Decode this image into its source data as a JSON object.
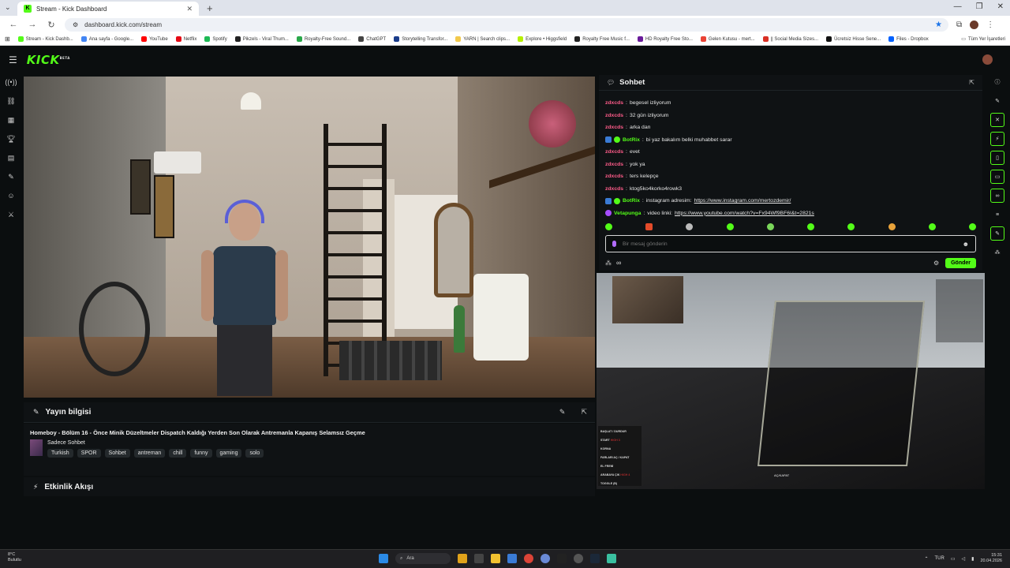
{
  "browser": {
    "tab_title": "Stream - Kick Dashboard",
    "new_tab_glyph": "+",
    "url": "dashboard.kick.com/stream",
    "window_controls": [
      "—",
      "❐",
      "✕"
    ]
  },
  "bookmarks": [
    {
      "label": "Stream - Kick Dashb...",
      "color": "#53fc18"
    },
    {
      "label": "Ana sayfa - Google...",
      "color": "#4285f4"
    },
    {
      "label": "YouTube",
      "color": "#ff0000"
    },
    {
      "label": "Netflix",
      "color": "#e50914"
    },
    {
      "label": "Spotify",
      "color": "#1db954"
    },
    {
      "label": "Pikzels - Viral Thum...",
      "color": "#222222"
    },
    {
      "label": "Royalty-Free Sound...",
      "color": "#2aa84a"
    },
    {
      "label": "ChatGPT",
      "color": "#444444"
    },
    {
      "label": "Storytelling Transfor...",
      "color": "#1a3c8a"
    },
    {
      "label": "YARN | Search clips...",
      "color": "#f2c94c"
    },
    {
      "label": "Explore • Higgsfield",
      "color": "#b6f000"
    },
    {
      "label": "Royalty Free Music f...",
      "color": "#222222"
    },
    {
      "label": "HD Royalty Free Sto...",
      "color": "#6a1b9a"
    },
    {
      "label": "Gelen Kutusu - mert...",
      "color": "#ea4335"
    },
    {
      "label": "|| Social Media Sizes...",
      "color": "#d93025"
    },
    {
      "label": "Ücretsiz Hisse Sene...",
      "color": "#111111"
    },
    {
      "label": "Files - Dropbox",
      "color": "#0061ff"
    }
  ],
  "bookmarks_all": "Tüm Yer İşaretleri",
  "kick": {
    "logo": "KICK",
    "logo_beta": "BETA"
  },
  "left_rail_icons": [
    "live-icon",
    "link-icon",
    "chart-icon",
    "trophy-icon",
    "media-icon",
    "wrench-icon",
    "users-icon",
    "mod-icon"
  ],
  "stream_info": {
    "heading": "Yayın bilgisi",
    "title": "Homeboy - Bölüm 16 - Önce Minik Düzeltmeler Dispatch Kaldığı Yerden Son Olarak Antremanla Kapanış Selamsız Geçme",
    "category": "Sadece Sohbet",
    "tags": [
      "Turkish",
      "SPOR",
      "Sohbet",
      "antreman",
      "chill",
      "funny",
      "gaming",
      "solo"
    ]
  },
  "activity": {
    "heading": "Etkinlik Akışı"
  },
  "chat": {
    "heading": "Sohbet",
    "messages": [
      {
        "user": "zdxcds",
        "color": "#ff5c8a",
        "text": "begesel izliyorum",
        "bot": false
      },
      {
        "user": "zdxcds",
        "color": "#ff5c8a",
        "text": "32 gün izliyorum",
        "bot": false
      },
      {
        "user": "zdxcds",
        "color": "#ff5c8a",
        "text": "arka dan",
        "bot": false
      },
      {
        "user": "BotRix",
        "color": "#53fc18",
        "text": "bi yaz bakalım belki muhabbet sarar",
        "bot": true
      },
      {
        "user": "zdxcds",
        "color": "#ff5c8a",
        "text": "evet",
        "bot": false
      },
      {
        "user": "zdxcds",
        "color": "#ff5c8a",
        "text": "yok ya",
        "bot": false
      },
      {
        "user": "zdxcds",
        "color": "#ff5c8a",
        "text": "ters kelepçe",
        "bot": false
      },
      {
        "user": "zdxcds",
        "color": "#ff5c8a",
        "text": "ktog5ko4korko4rowk3",
        "bot": false
      },
      {
        "user": "BotRix",
        "color": "#53fc18",
        "text": "instagram adresim: ",
        "link": "https://www.instagram.com/mertozdemir/",
        "bot": true
      },
      {
        "user": "Vetapunga",
        "color": "#53fc18",
        "text": "video linki: ",
        "link": "https://www.youtube.com/watch?v=Fx94Wf9BF6I&t=2821s",
        "bot": false
      }
    ],
    "input_placeholder": "Bir mesaj gönderin",
    "send_label": "Gönder",
    "infinity": "∞"
  },
  "preview": {
    "menu": [
      {
        "label": "BAŞLAT / DURDUR",
        "extra": ""
      },
      {
        "label": "START",
        "extra": "HIGH 3"
      },
      {
        "label": "KORNA",
        "extra": ""
      },
      {
        "label": "FARLARI AÇ / KAPAT",
        "extra": ""
      },
      {
        "label": "EL FRENİ",
        "extra": ""
      },
      {
        "label": "ARABAYA ÇIK",
        "extra": "HIGH 4"
      },
      {
        "label": "TOGGLE (B)",
        "extra": ""
      }
    ],
    "hud": "AÇ/KAPAT"
  },
  "right_rail_icons": [
    "info-icon",
    "pencil-icon",
    "close-icon",
    "bolt-icon",
    "clipboard-icon",
    "chat-icon",
    "link-icon",
    "stack-icon",
    "wrench-icon",
    "nodes-icon"
  ],
  "taskbar": {
    "temp": "8°C",
    "weather": "Bulutlu",
    "search": "Ara",
    "lang": "TUR",
    "time": "15:31",
    "date": "20.04.2026"
  },
  "colors": {
    "accent": "#53fc18",
    "background": "#0b0e0f",
    "panel": "#0f1214"
  }
}
